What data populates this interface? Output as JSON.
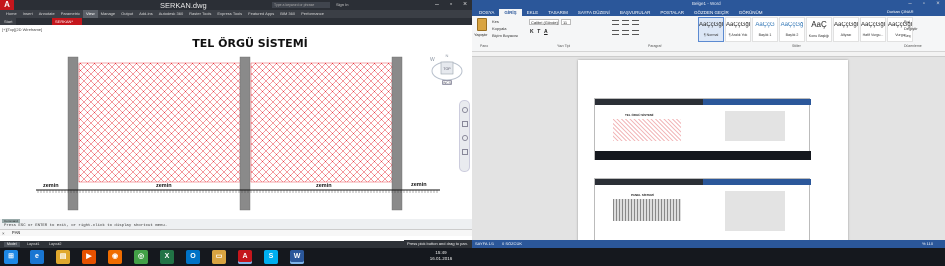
{
  "autocad": {
    "window_title": "SERKAN.dwg",
    "search_placeholder": "Type a keyword or phrase",
    "signin": "Sign In",
    "ribbon_tabs": [
      "Home",
      "Insert",
      "Annotate",
      "Parametric",
      "View",
      "Manage",
      "Output",
      "Add-ins",
      "Autodesk 360",
      "Raster Tools",
      "Express Tools",
      "Featured Apps",
      "BIM 360",
      "Performance"
    ],
    "active_ribbon_tab": "View",
    "doc_tabs": [
      "Start",
      "SERKAN*"
    ],
    "viewport_label": "[+][Top][2D Wireframe]",
    "drawing_title": "TEL ÖRGÜ SİSTEMİ",
    "ground_labels": [
      "zemin",
      "zemin",
      "zemin",
      "zemin"
    ],
    "viewcube_label": "TOP",
    "wcs_label": "WCS",
    "cmd_header": "Command",
    "cmd_history": "Press ESC or ENTER to exit, or right-click to display shortcut menu.",
    "cmd_prompt": "PAN",
    "layout_tabs": [
      "Model",
      "Layout1",
      "Layout2"
    ],
    "status_hint": "Press pick button and drag to pan."
  },
  "word": {
    "window_title": "Belge1 - Word",
    "tabs": [
      "DOSYA",
      "GİRİŞ",
      "EKLE",
      "TASARIM",
      "SAYFA DÜZENİ",
      "BAŞVURULAR",
      "POSTALAR",
      "GÖZDEN GEÇİR",
      "GÖRÜNÜM"
    ],
    "active_tab": "GİRİŞ",
    "user": "Durkan ÇINAR",
    "paste_label": "Yapıştır",
    "clipboard_items": [
      "Kes",
      "Kopyala",
      "Biçim Boyacısı"
    ],
    "font_name": "Calibri (Gövde)",
    "font_size": "11",
    "format_buttons": [
      "K",
      "T",
      "A"
    ],
    "group_labels": [
      "Pano",
      "Yazı Tipi",
      "Paragraf",
      "Stiller",
      "Düzenleme"
    ],
    "styles": [
      {
        "sample": "AaÇçĞğİ",
        "name": "¶ Normal"
      },
      {
        "sample": "AaÇçĞğİ",
        "name": "¶ Aralık Yok"
      },
      {
        "sample": "AaÇçĞ",
        "name": "Başlık 1"
      },
      {
        "sample": "AaÇçĞğ",
        "name": "Başlık 2"
      },
      {
        "sample": "AaÇ",
        "name": "Konu Başlığı"
      },
      {
        "sample": "AaÇçĞğİ",
        "name": "Altyazı"
      },
      {
        "sample": "AaÇçĞğİ",
        "name": "Hafif Vurgu..."
      },
      {
        "sample": "AaÇçĞğİ",
        "name": "Vurgu"
      }
    ],
    "edit_items": [
      "Bul",
      "Değiştir",
      "Seç"
    ],
    "page_info": "SAYFA 1/1",
    "word_count": "0 SÖZCÜK",
    "zoom": "% 110",
    "embedded_title_1": "TEL ÖRGÜ SİSTEMİ",
    "embedded_title_2": "PANEL SİSTEMİ"
  },
  "taskbar": {
    "time": "15:49",
    "date": "16.01.2016",
    "icons": [
      "start-icon",
      "ie-icon",
      "explorer-icon",
      "media-player-icon",
      "firefox-icon",
      "chrome-icon",
      "excel-icon",
      "outlook-icon",
      "folder-icon",
      "autocad-icon",
      "skype-icon",
      "word-icon"
    ]
  },
  "colors": {
    "autocad_red": "#c4161c",
    "word_blue": "#2b579a",
    "hatch_red": "#e8202a",
    "post_gray": "#8a8a8a"
  }
}
